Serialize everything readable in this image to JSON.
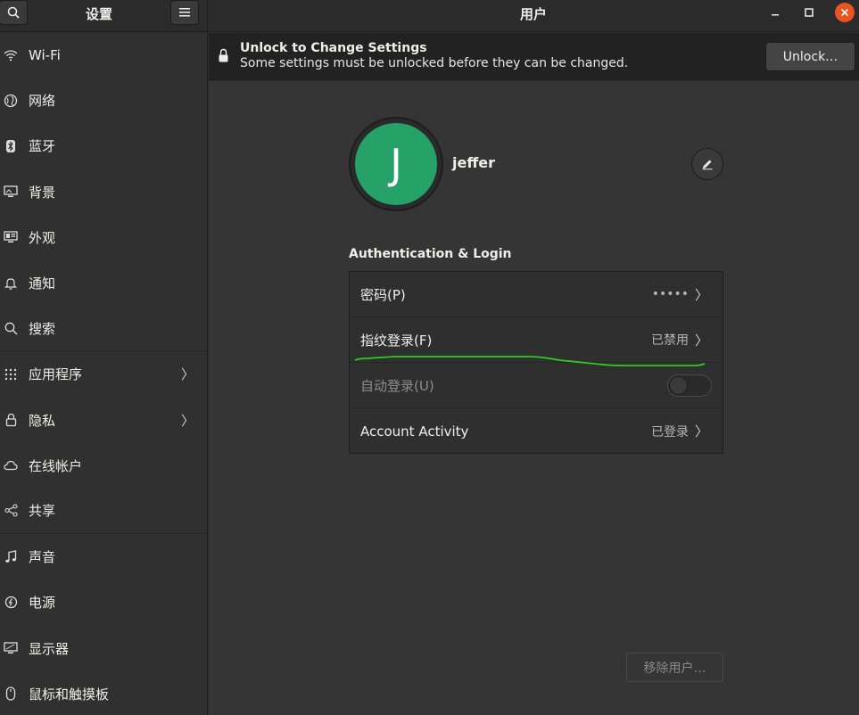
{
  "header": {
    "sidebar_title": "设置",
    "main_title": "用户"
  },
  "sidebar": {
    "items": [
      {
        "label": "Wi-Fi",
        "icon": "wifi-icon"
      },
      {
        "label": "网络",
        "icon": "network-icon"
      },
      {
        "label": "蓝牙",
        "icon": "bluetooth-icon"
      },
      {
        "label": "背景",
        "icon": "background-icon"
      },
      {
        "label": "外观",
        "icon": "appearance-icon"
      },
      {
        "label": "通知",
        "icon": "bell-icon"
      },
      {
        "label": "搜索",
        "icon": "search-icon"
      },
      {
        "label": "应用程序",
        "icon": "apps-grid-icon",
        "chevron": "〉"
      },
      {
        "label": "隐私",
        "icon": "lock-icon",
        "chevron": "〉"
      },
      {
        "label": "在线帐户",
        "icon": "cloud-icon"
      },
      {
        "label": "共享",
        "icon": "share-icon"
      },
      {
        "label": "声音",
        "icon": "music-note-icon"
      },
      {
        "label": "电源",
        "icon": "power-icon"
      },
      {
        "label": "显示器",
        "icon": "display-icon"
      },
      {
        "label": "鼠标和触摸板",
        "icon": "mouse-icon"
      }
    ]
  },
  "infobar": {
    "title": "Unlock to Change Settings",
    "subtitle": "Some settings must be unlocked before they can be changed.",
    "unlock_label": "Unlock…"
  },
  "user": {
    "initial": "J",
    "name": "jeffer",
    "avatar_color": "#26a269"
  },
  "auth": {
    "section_title": "Authentication & Login",
    "rows": [
      {
        "label": "密码(P)",
        "value": "•••••",
        "chevron": "〉"
      },
      {
        "label": "指纹登录(F)",
        "value": "已禁用",
        "chevron": "〉"
      },
      {
        "label": "自动登录(U)",
        "toggle": false
      },
      {
        "label": "Account Activity",
        "value": "已登录",
        "chevron": "〉"
      }
    ]
  },
  "remove_label": "移除用户…",
  "colors": {
    "accent_close": "#e95420",
    "annotation_line": "#2ecc1f"
  }
}
